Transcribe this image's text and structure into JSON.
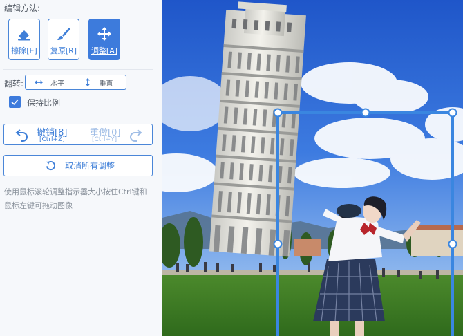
{
  "panel": {
    "edit_method_label": "编辑方法:",
    "modes": [
      {
        "label": "擦除[E]",
        "icon": "eraser-icon",
        "active": false
      },
      {
        "label": "复原[R]",
        "icon": "brush-icon",
        "active": false
      },
      {
        "label": "调整[A]",
        "icon": "move-icon",
        "active": true
      }
    ],
    "flip": {
      "label": "翻转:",
      "horizontal": "水平",
      "vertical": "垂直"
    },
    "keep_ratio": {
      "label": "保持比例",
      "checked": true
    },
    "undo": {
      "label": "撤销[8]",
      "shortcut": "[Ctrl+Z]"
    },
    "redo": {
      "label": "重做[0]",
      "shortcut": "[Ctrl+Y]"
    },
    "reset_label": "取消所有调整",
    "hint": "使用鼠标滚轮调整指示器大小按住Ctrl键和鼠标左键可拖动图像"
  },
  "colors": {
    "accent": "#3d7bdc",
    "panel_bg": "#f6f8fb",
    "selection": "#3a86e0"
  }
}
